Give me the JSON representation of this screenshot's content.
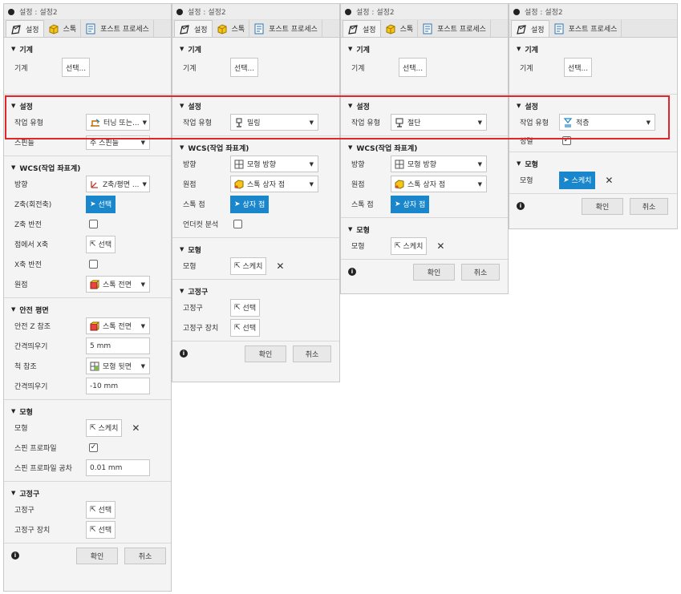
{
  "colors": {
    "accent_blue": "#1a87cc",
    "highlight_red": "#e0262a"
  },
  "panels": [
    {
      "title": "설정 : 설정2",
      "tabs": [
        "설정",
        "스톡",
        "포스트 프로세스"
      ],
      "machine": {
        "header": "기계",
        "label": "기계",
        "button": "선택..."
      },
      "setup": {
        "header": "설정",
        "op_type_label": "작업 유형",
        "op_type_value": "터닝 또는...",
        "spindle_label": "스핀들",
        "spindle_value": "주 스핀들"
      },
      "wcs": {
        "header": "WCS(작업 좌표계)",
        "orientation_label": "방향",
        "orientation_value": "Z축/평면 ...",
        "zaxis_label": "Z축(회전축)",
        "zaxis_button": "선택",
        "zflip_label": "Z축 반전",
        "xaxis_label": "점에서 X축",
        "xaxis_button": "선택",
        "xflip_label": "X축 반전",
        "origin_label": "원점",
        "origin_value": "스톡 전면"
      },
      "safe": {
        "header": "안전 평면",
        "safez_label": "안전 Z 참조",
        "safez_value": "스톡 전면",
        "clear1_label": "간격띄우기",
        "clear1_value": "5 mm",
        "chuck_label": "척 참조",
        "chuck_value": "모형 뒷면",
        "clear2_label": "간격띄우기",
        "clear2_value": "-10 mm"
      },
      "model": {
        "header": "모형",
        "model_label": "모형",
        "model_button": "스케치",
        "spun_label": "스핀 프로파일",
        "spun_tol_label": "스핀 프로파일 공차",
        "spun_tol_value": "0.01 mm"
      },
      "fixture": {
        "header": "고정구",
        "fixture_label": "고정구",
        "fixture_button": "선택",
        "device_label": "고정구 장치",
        "device_button": "선택"
      },
      "ok": "확인",
      "cancel": "취소"
    },
    {
      "title": "설정 : 설정2",
      "tabs": [
        "설정",
        "스톡",
        "포스트 프로세스"
      ],
      "machine": {
        "header": "기계",
        "label": "기계",
        "button": "선택..."
      },
      "setup": {
        "header": "설정",
        "op_type_label": "작업 유형",
        "op_type_value": "밀링"
      },
      "wcs": {
        "header": "WCS(작업 좌표계)",
        "orientation_label": "방향",
        "orientation_value": "모형 방향",
        "origin_label": "원점",
        "origin_value": "스톡 상자 점",
        "stockpt_label": "스톡 점",
        "stockpt_button": "상자 점",
        "undercut_label": "언더컷 분석"
      },
      "model": {
        "header": "모형",
        "model_label": "모형",
        "model_button": "스케치"
      },
      "fixture": {
        "header": "고정구",
        "fixture_label": "고정구",
        "fixture_button": "선택",
        "device_label": "고정구 장치",
        "device_button": "선택"
      },
      "ok": "확인",
      "cancel": "취소"
    },
    {
      "title": "설정 : 설정2",
      "tabs": [
        "설정",
        "스톡",
        "포스트 프로세스"
      ],
      "machine": {
        "header": "기계",
        "label": "기계",
        "button": "선택..."
      },
      "setup": {
        "header": "설정",
        "op_type_label": "작업 유형",
        "op_type_value": "절단"
      },
      "wcs": {
        "header": "WCS(작업 좌표계)",
        "orientation_label": "방향",
        "orientation_value": "모형 방향",
        "origin_label": "원점",
        "origin_value": "스톡 상자 점",
        "stockpt_label": "스톡 점",
        "stockpt_button": "상자 점"
      },
      "model": {
        "header": "모형",
        "model_label": "모형",
        "model_button": "스케치"
      },
      "ok": "확인",
      "cancel": "취소"
    },
    {
      "title": "설정 : 설정2",
      "tabs": [
        "설정",
        "포스트 프로세스"
      ],
      "machine": {
        "header": "기계",
        "label": "기계",
        "button": "선택..."
      },
      "setup": {
        "header": "설정",
        "op_type_label": "작업 유형",
        "op_type_value": "적층",
        "orient_label": "정렬"
      },
      "model": {
        "header": "모형",
        "model_label": "모형",
        "model_button": "스케치"
      },
      "ok": "확인",
      "cancel": "취소"
    }
  ]
}
